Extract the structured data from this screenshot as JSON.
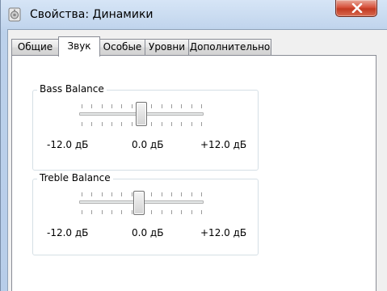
{
  "window": {
    "title": "Свойства: Динамики",
    "icon": "speaker-icon",
    "close_icon": "close-icon"
  },
  "tabs": [
    {
      "label": "Общие",
      "active": false
    },
    {
      "label": "Звук",
      "active": true
    },
    {
      "label": "Особые",
      "active": false
    },
    {
      "label": "Уровни",
      "active": false
    },
    {
      "label": "Дополнительно",
      "active": false
    }
  ],
  "bass": {
    "title": "Bass Balance",
    "min_label": "-12.0 дБ",
    "mid_label": "0.0 дБ",
    "max_label": "+12.0 дБ",
    "value_db": 0.0,
    "range_db": [
      -12,
      12
    ],
    "tick_count": 13
  },
  "treble": {
    "title": "Treble Balance",
    "min_label": "-12.0 дБ",
    "mid_label": "0.0 дБ",
    "max_label": "+12.0 дБ",
    "value_db": -0.5,
    "range_db": [
      -12,
      12
    ],
    "tick_count": 13
  },
  "colors": {
    "close_button": "#c9452c",
    "titlebar": "#c4d7ee"
  }
}
